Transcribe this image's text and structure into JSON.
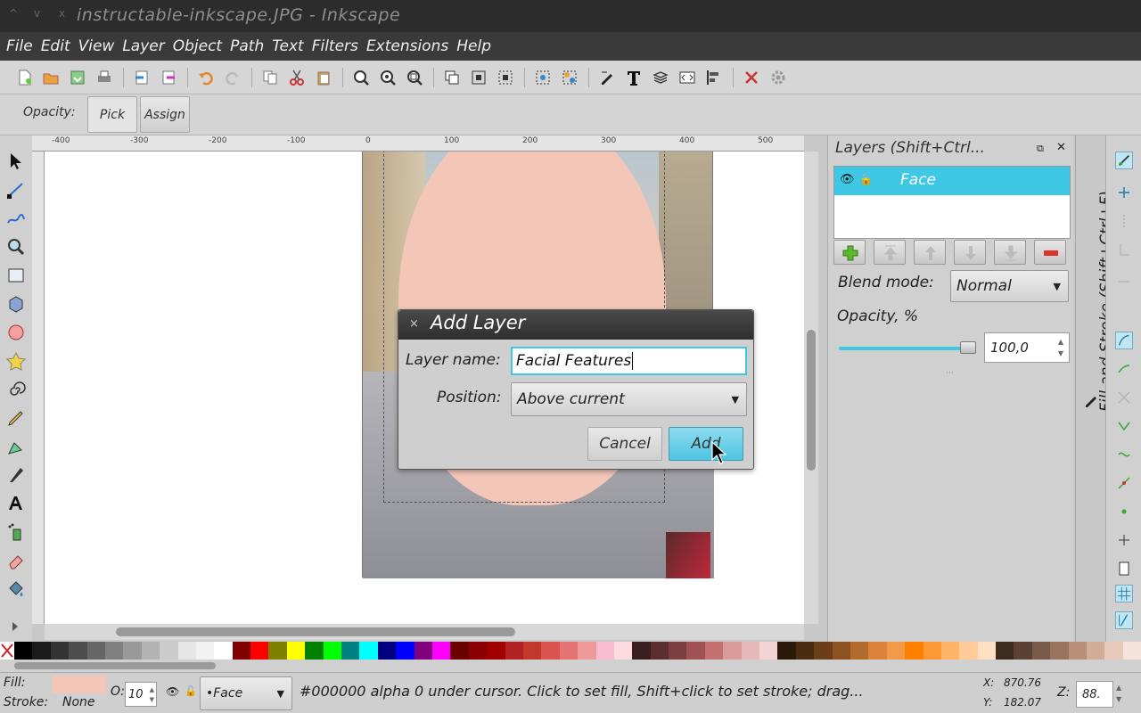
{
  "window": {
    "title": "instructable-inkscape.JPG - Inkscape",
    "controls": [
      "^",
      "v",
      "x"
    ]
  },
  "menu": [
    "File",
    "Edit",
    "View",
    "Layer",
    "Object",
    "Path",
    "Text",
    "Filters",
    "Extensions",
    "Help"
  ],
  "control_bar": {
    "opacity_label": "Opacity:",
    "pick_label": "Pick",
    "assign_label": "Assign"
  },
  "ruler": {
    "ticks": [
      "-400",
      "-300",
      "-200",
      "-100",
      "0",
      "100",
      "200",
      "300",
      "400",
      "500"
    ]
  },
  "layers_panel": {
    "title": "Layers (Shift+Ctrl...",
    "layer_name": "Face",
    "blend_label": "Blend mode:",
    "blend_value": "Normal",
    "opacity_label": "Opacity, %",
    "opacity_value": "100,0",
    "opacity_fraction": 1.0
  },
  "side_tab": "Fill and Stroke (Shift+Ctrl+F)",
  "dialog": {
    "title": "Add Layer",
    "close": "×",
    "name_label": "Layer name:",
    "name_value": "Facial Features",
    "position_label": "Position:",
    "position_value": "Above current",
    "cancel_label": "Cancel",
    "add_label": "Add"
  },
  "status": {
    "fill_label": "Fill:",
    "stroke_label": "Stroke:",
    "stroke_value": "None",
    "fill_color": "#f3c6b8",
    "opacity_prefix": "O:",
    "opacity_value": "10",
    "layer_value": "•Face",
    "message": "#000000 alpha 0 under cursor. Click to set fill, Shift+click to set stroke; drag...",
    "x_label": "X:",
    "x_value": "870.76",
    "y_label": "Y:",
    "y_value": "182.07",
    "zoom_label": "Z:",
    "zoom_value": "88."
  },
  "colors": {
    "accent": "#3ec8e6",
    "face": "#f3c6b8"
  },
  "palette": [
    "#000000",
    "#1a1a1a",
    "#333333",
    "#4d4d4d",
    "#666666",
    "#808080",
    "#999999",
    "#b3b3b3",
    "#cccccc",
    "#e6e6e6",
    "#f2f2f2",
    "#ffffff",
    "#800000",
    "#ff0000",
    "#808000",
    "#ffff00",
    "#008000",
    "#00ff00",
    "#008080",
    "#00ffff",
    "#000080",
    "#0000ff",
    "#800080",
    "#ff00ff",
    "#6b0000",
    "#8b0000",
    "#a00000",
    "#b22222",
    "#c0392b",
    "#d9534f",
    "#e57373",
    "#ef9a9a",
    "#f8bbd0",
    "#fcdce0",
    "#3b1e1e",
    "#5d2e2e",
    "#7b3f3f",
    "#a05252",
    "#c27070",
    "#d99a9a",
    "#e6b8b8",
    "#f2d4d4",
    "#2b1a0a",
    "#4a2c12",
    "#6b3e1a",
    "#8c5222",
    "#b36b2d",
    "#d9843a",
    "#f29a4a",
    "#ff7f00",
    "#ff9933",
    "#ffb366",
    "#ffcc99",
    "#ffe0c2",
    "#3d2b1f",
    "#5c4033",
    "#7a5a48",
    "#99735e",
    "#b88f78",
    "#d1ad98",
    "#e6c9b8",
    "#f4e3d8"
  ]
}
